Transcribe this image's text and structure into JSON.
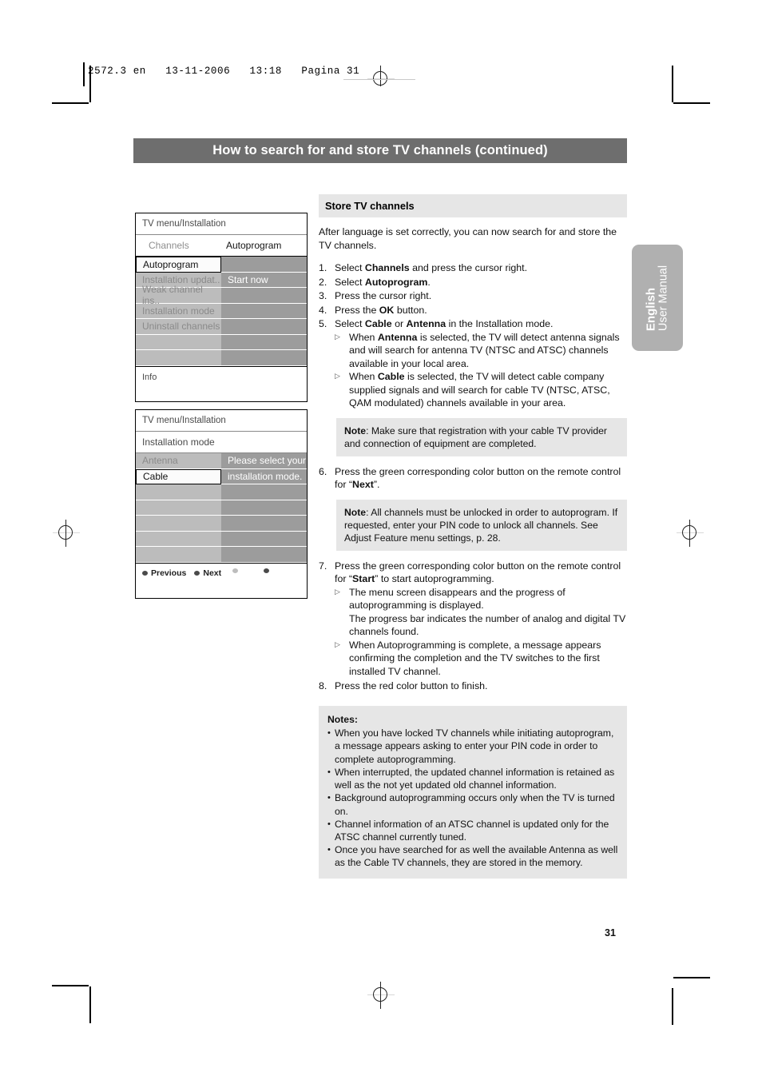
{
  "print_header": {
    "text": "2572.3 en   13-11-2006   13:18   Pagina 31"
  },
  "title_bar": {
    "text": "How to search for and store TV channels (continued)"
  },
  "side_tab": {
    "language": "English",
    "manual": "User Manual",
    "color": "#b0b0b0"
  },
  "tv_menu_1": {
    "title": "TV menu/Installation",
    "sub_left": "Channels",
    "sub_right": "Autoprogram",
    "rows": [
      {
        "left": "Autoprogram",
        "right": "",
        "selected": true
      },
      {
        "left": "Installation updat..",
        "right": "Start now",
        "selected": false
      },
      {
        "left": "Weak channel ins..",
        "right": "",
        "selected": false
      },
      {
        "left": "Installation mode",
        "right": "",
        "selected": false
      },
      {
        "left": "Uninstall channels",
        "right": "",
        "selected": false
      },
      {
        "left": "",
        "right": "",
        "selected": false
      },
      {
        "left": "",
        "right": "",
        "selected": false
      }
    ],
    "info_label": "Info"
  },
  "tv_menu_2": {
    "title": "TV menu/Installation",
    "sub_left": "Installation mode",
    "rows": [
      {
        "left": "Antenna",
        "right": "Please select your",
        "selected": false
      },
      {
        "left": "Cable",
        "right": "installation mode.",
        "selected": true
      },
      {
        "left": "",
        "right": "",
        "selected": false
      },
      {
        "left": "",
        "right": "",
        "selected": false
      },
      {
        "left": "",
        "right": "",
        "selected": false
      },
      {
        "left": "",
        "right": "",
        "selected": false
      },
      {
        "left": "",
        "right": "",
        "selected": false
      }
    ],
    "nav": {
      "previous": "Previous",
      "next": "Next"
    }
  },
  "main": {
    "section_heading": "Store TV channels",
    "intro": "After language is set correctly, you can now search for and store the TV channels.",
    "steps": [
      {
        "num": "1.",
        "parts": [
          {
            "t": "Select ",
            "b": false
          },
          {
            "t": "Channels",
            "b": true
          },
          {
            "t": " and press the cursor right.",
            "b": false
          }
        ]
      },
      {
        "num": "2.",
        "parts": [
          {
            "t": "Select ",
            "b": false
          },
          {
            "t": "Autoprogram",
            "b": true
          },
          {
            "t": ".",
            "b": false
          }
        ]
      },
      {
        "num": "3.",
        "parts": [
          {
            "t": "Press the cursor right.",
            "b": false
          }
        ]
      },
      {
        "num": "4.",
        "parts": [
          {
            "t": "Press the ",
            "b": false
          },
          {
            "t": "OK",
            "b": true
          },
          {
            "t": " button.",
            "b": false
          }
        ]
      },
      {
        "num": "5.",
        "parts": [
          {
            "t": "Select ",
            "b": false
          },
          {
            "t": "Cable",
            "b": true
          },
          {
            "t": " or ",
            "b": false
          },
          {
            "t": "Antenna",
            "b": true
          },
          {
            "t": " in the Installation mode.",
            "b": false
          }
        ],
        "subs": [
          [
            {
              "t": "When ",
              "b": false
            },
            {
              "t": "Antenna",
              "b": true
            },
            {
              "t": " is selected, the TV will detect antenna signals and will search for antenna TV (NTSC and ATSC) channels available in your local area.",
              "b": false
            }
          ],
          [
            {
              "t": "When ",
              "b": false
            },
            {
              "t": "Cable",
              "b": true
            },
            {
              "t": " is selected, the TV will detect cable company supplied signals and will search for cable TV (NTSC, ATSC, QAM modulated) channels available in your area.",
              "b": false
            }
          ]
        ]
      }
    ],
    "note_1": [
      {
        "t": "Note",
        "b": true
      },
      {
        "t": ": Make sure that registration with your cable TV provider and connection of equipment are completed.",
        "b": false
      }
    ],
    "step_6": {
      "num": "6.",
      "parts": [
        {
          "t": "Press the green corresponding color button on the remote control for “",
          "b": false
        },
        {
          "t": "Next",
          "b": true
        },
        {
          "t": "”.",
          "b": false
        }
      ]
    },
    "note_2": [
      {
        "t": "Note",
        "b": true
      },
      {
        "t": ": All channels must be unlocked in order to autoprogram. If requested, enter your PIN code to unlock all channels. See Adjust Feature menu settings, p. 28.",
        "b": false
      }
    ],
    "step_7": {
      "num": "7.",
      "parts": [
        {
          "t": "Press the green corresponding color button on the remote control for “",
          "b": false
        },
        {
          "t": "Start",
          "b": true
        },
        {
          "t": "” to start autoprogramming.",
          "b": false
        }
      ],
      "subs": [
        [
          {
            "t": "The menu screen disappears and the progress of autoprogramming is displayed.",
            "b": false
          },
          {
            "t": "\nThe progress bar indicates the number of analog and digital TV channels found.",
            "b": false
          }
        ],
        [
          {
            "t": "When Autoprogramming is complete, a message appears confirming the completion and the TV switches to the first installed TV channel.",
            "b": false
          }
        ]
      ]
    },
    "step_8": {
      "num": "8.",
      "parts": [
        {
          "t": "Press the red color button to finish.",
          "b": false
        }
      ]
    },
    "notes_title": "Notes",
    "notes_title_colon": ":",
    "notes": [
      "When you have locked TV channels while initiating autoprogram, a message appears asking to enter your PIN code in order to complete autoprogramming.",
      "When interrupted, the updated channel information is retained as well as the not yet updated old channel information.",
      "Background autoprogramming occurs only when the TV is turned on.",
      "Channel information of an ATSC channel is updated only for the ATSC channel currently tuned.",
      "Once you have searched for as well the available Antenna as well as the Cable TV channels, they are stored in the memory."
    ]
  },
  "page_number": "31"
}
